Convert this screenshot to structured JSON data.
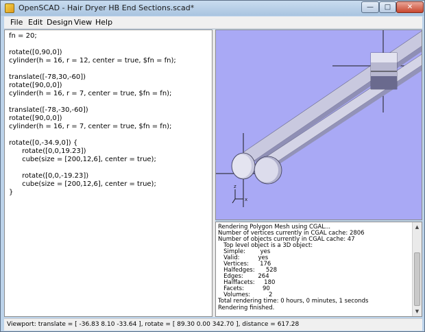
{
  "window": {
    "title": "OpenSCAD - Hair Dryer HB End Sections.scad*",
    "controls": {
      "minimize": "—",
      "maximize": "□",
      "close": "✕"
    }
  },
  "menu": {
    "items": [
      {
        "label": "File"
      },
      {
        "label": "Edit"
      },
      {
        "label": "Design"
      },
      {
        "label": "View"
      },
      {
        "label": "Help"
      }
    ]
  },
  "editor": {
    "lines": [
      "fn = 20;",
      "",
      "rotate([0,90,0])",
      "cylinder(h = 16, r = 12, center = true, $fn = fn);",
      "",
      "translate([-78,30,-60])",
      "rotate([90,0,0])",
      "cylinder(h = 16, r = 7, center = true, $fn = fn);",
      "",
      "translate([-78,-30,-60])",
      "rotate([90,0,0])",
      "cylinder(h = 16, r = 7, center = true, $fn = fn);",
      "",
      "rotate([0,-34.9,0]) {",
      "      rotate([0,0,19.23])",
      "      cube(size = [200,12,6], center = true);",
      "",
      "      rotate([0,0,-19.23])",
      "      cube(size = [200,12,6], center = true);",
      "}"
    ]
  },
  "viewport": {
    "background": "#a9a9f5",
    "axes_labels": {
      "z": "z",
      "x": "x"
    }
  },
  "console": {
    "lines": [
      "Rendering Polygon Mesh using CGAL...",
      "Number of vertices currently in CGAL cache: 2806",
      "Number of objects currently in CGAL cache: 47",
      "   Top level object is a 3D object:",
      "   Simple:        yes",
      "   Valid:          yes",
      "   Vertices:      176",
      "   Halfedges:      528",
      "   Edges:        264",
      "   Halffacets:     180",
      "   Facets:          90",
      "   Volumes:          2",
      "Total rendering time: 0 hours, 0 minutes, 1 seconds",
      "Rendering finished."
    ]
  },
  "status": {
    "text": "Viewport: translate = [ -36.83 8.10 -33.64 ], rotate = [ 89.30 0.00 342.70 ], distance = 617.28"
  }
}
